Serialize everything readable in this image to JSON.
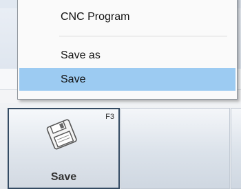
{
  "menu": {
    "items": [
      {
        "label": "CNC Program"
      },
      {
        "label": "Save as"
      },
      {
        "label": "Save",
        "highlighted": true
      }
    ],
    "highlight_color": "#9ccbf2"
  },
  "toolbar": {
    "save_button": {
      "label": "Save",
      "shortcut": "F3",
      "icon": "floppy-disk-icon"
    }
  },
  "colors": {
    "active_button_border": "#344b63"
  }
}
